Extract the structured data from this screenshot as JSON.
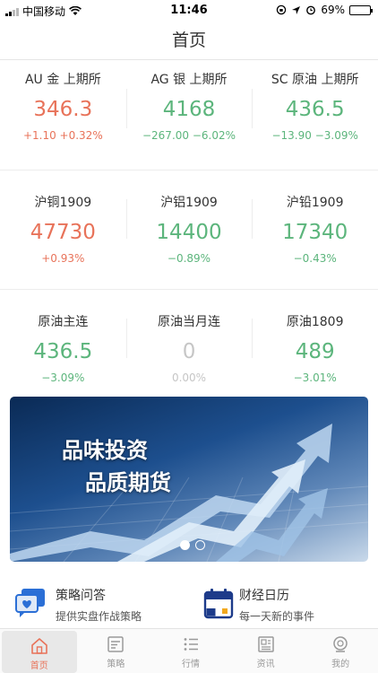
{
  "status_bar": {
    "carrier": "中国移动",
    "time": "11:46",
    "battery": "69%",
    "battery_level": 0.69
  },
  "header": {
    "title": "首页"
  },
  "quotes": [
    [
      {
        "name": "AU 金 上期所",
        "price": "346.3",
        "change": "+1.10 +0.32%",
        "trend": "up"
      },
      {
        "name": "AG 银 上期所",
        "price": "4168",
        "change": "−267.00 −6.02%",
        "trend": "down"
      },
      {
        "name": "SC 原油 上期所",
        "price": "436.5",
        "change": "−13.90 −3.09%",
        "trend": "down"
      }
    ],
    [
      {
        "name": "沪铜1909",
        "price": "47730",
        "change": "+0.93%",
        "trend": "up"
      },
      {
        "name": "沪铝1909",
        "price": "14400",
        "change": "−0.89%",
        "trend": "down"
      },
      {
        "name": "沪铅1909",
        "price": "17340",
        "change": "−0.43%",
        "trend": "down"
      }
    ],
    [
      {
        "name": "原油主连",
        "price": "436.5",
        "change": "−3.09%",
        "trend": "down"
      },
      {
        "name": "原油当月连",
        "price": "0",
        "change": "0.00%",
        "trend": "flat"
      },
      {
        "name": "原油1809",
        "price": "489",
        "change": "−3.01%",
        "trend": "down"
      }
    ]
  ],
  "banner": {
    "line1": "品味投资",
    "line2": "品质期货",
    "slide_count": 2,
    "active_slide": 0
  },
  "features": [
    {
      "title": "策略问答",
      "subtitle": "提供实盘作战策略",
      "icon": "chat-bubble-heart-icon"
    },
    {
      "title": "财经日历",
      "subtitle": "每一天新的事件",
      "icon": "calendar-icon"
    }
  ],
  "tabbar": [
    {
      "label": "首页",
      "icon": "home-icon",
      "active": true
    },
    {
      "label": "策略",
      "icon": "strategy-doc-icon",
      "active": false
    },
    {
      "label": "行情",
      "icon": "market-list-icon",
      "active": false
    },
    {
      "label": "资讯",
      "icon": "news-icon",
      "active": false
    },
    {
      "label": "我的",
      "icon": "profile-icon",
      "active": false
    }
  ],
  "colors": {
    "up": "#e8735a",
    "down": "#5cb57c",
    "flat": "#c6c6c6",
    "accent": "#e8735a"
  }
}
